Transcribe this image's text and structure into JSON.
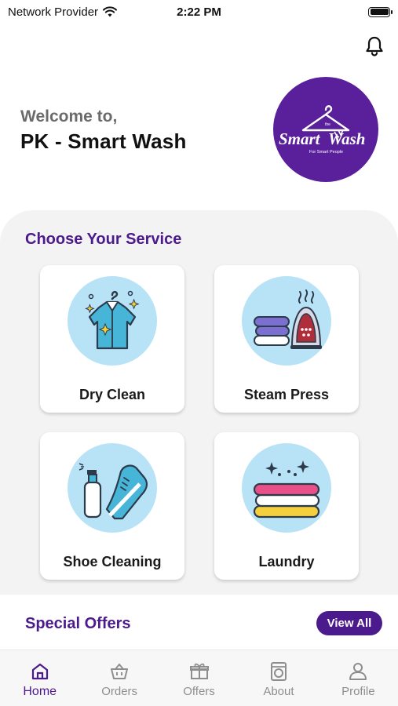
{
  "status_bar": {
    "carrier": "Network Provider",
    "time": "2:22 PM",
    "battery_level": 1.0
  },
  "header": {
    "welcome_line": "Welcome to,",
    "store_name": "PK - Smart Wash",
    "notification_icon": "bell-icon"
  },
  "logo": {
    "small_text": "the",
    "brand_word1": "Smart",
    "brand_word2": "Wash",
    "tagline": "For Smart People",
    "background": "#5a1f9a"
  },
  "services": {
    "title": "Choose Your Service",
    "items": [
      {
        "label": "Dry Clean",
        "icon": "shirt-hanger-icon"
      },
      {
        "label": "Steam Press",
        "icon": "iron-towels-icon"
      },
      {
        "label": "Shoe Cleaning",
        "icon": "shoe-spray-icon"
      },
      {
        "label": "Laundry",
        "icon": "folded-clothes-icon"
      }
    ]
  },
  "offers": {
    "title": "Special Offers",
    "view_all_label": "View All"
  },
  "bottom_nav": {
    "items": [
      {
        "label": "Home",
        "icon": "home-icon",
        "active": true
      },
      {
        "label": "Orders",
        "icon": "basket-icon",
        "active": false
      },
      {
        "label": "Offers",
        "icon": "gift-icon",
        "active": false
      },
      {
        "label": "About",
        "icon": "washing-machine-icon",
        "active": false
      },
      {
        "label": "Profile",
        "icon": "person-icon",
        "active": false
      }
    ]
  },
  "colors": {
    "accent": "#4b1a8c",
    "panel_bg": "#f3f3f3",
    "icon_circle": "#b8e3f7"
  }
}
